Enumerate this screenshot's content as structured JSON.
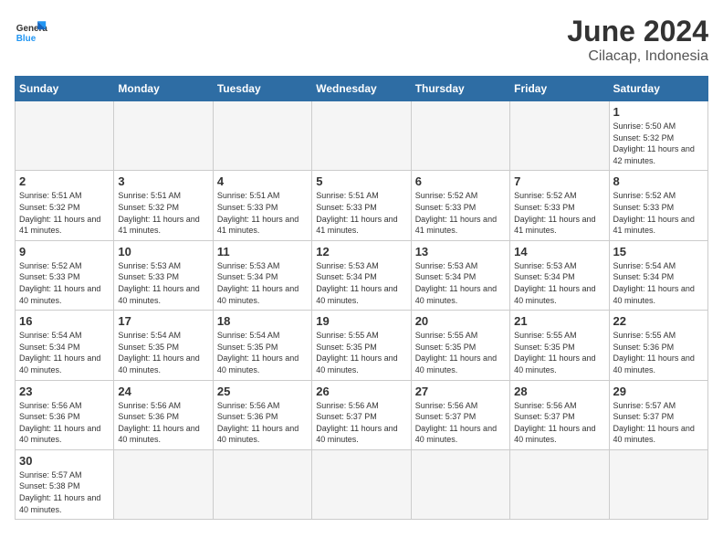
{
  "header": {
    "logo_general": "General",
    "logo_blue": "Blue",
    "title": "June 2024",
    "subtitle": "Cilacap, Indonesia"
  },
  "days_of_week": [
    "Sunday",
    "Monday",
    "Tuesday",
    "Wednesday",
    "Thursday",
    "Friday",
    "Saturday"
  ],
  "weeks": [
    [
      {
        "day": "",
        "sunrise": "",
        "sunset": "",
        "daylight": "",
        "empty": true
      },
      {
        "day": "",
        "sunrise": "",
        "sunset": "",
        "daylight": "",
        "empty": true
      },
      {
        "day": "",
        "sunrise": "",
        "sunset": "",
        "daylight": "",
        "empty": true
      },
      {
        "day": "",
        "sunrise": "",
        "sunset": "",
        "daylight": "",
        "empty": true
      },
      {
        "day": "",
        "sunrise": "",
        "sunset": "",
        "daylight": "",
        "empty": true
      },
      {
        "day": "",
        "sunrise": "",
        "sunset": "",
        "daylight": "",
        "empty": true
      },
      {
        "day": "1",
        "sunrise": "Sunrise: 5:50 AM",
        "sunset": "Sunset: 5:32 PM",
        "daylight": "Daylight: 11 hours and 42 minutes.",
        "empty": false
      }
    ],
    [
      {
        "day": "2",
        "sunrise": "Sunrise: 5:51 AM",
        "sunset": "Sunset: 5:32 PM",
        "daylight": "Daylight: 11 hours and 41 minutes.",
        "empty": false
      },
      {
        "day": "3",
        "sunrise": "Sunrise: 5:51 AM",
        "sunset": "Sunset: 5:32 PM",
        "daylight": "Daylight: 11 hours and 41 minutes.",
        "empty": false
      },
      {
        "day": "4",
        "sunrise": "Sunrise: 5:51 AM",
        "sunset": "Sunset: 5:33 PM",
        "daylight": "Daylight: 11 hours and 41 minutes.",
        "empty": false
      },
      {
        "day": "5",
        "sunrise": "Sunrise: 5:51 AM",
        "sunset": "Sunset: 5:33 PM",
        "daylight": "Daylight: 11 hours and 41 minutes.",
        "empty": false
      },
      {
        "day": "6",
        "sunrise": "Sunrise: 5:52 AM",
        "sunset": "Sunset: 5:33 PM",
        "daylight": "Daylight: 11 hours and 41 minutes.",
        "empty": false
      },
      {
        "day": "7",
        "sunrise": "Sunrise: 5:52 AM",
        "sunset": "Sunset: 5:33 PM",
        "daylight": "Daylight: 11 hours and 41 minutes.",
        "empty": false
      },
      {
        "day": "8",
        "sunrise": "Sunrise: 5:52 AM",
        "sunset": "Sunset: 5:33 PM",
        "daylight": "Daylight: 11 hours and 41 minutes.",
        "empty": false
      }
    ],
    [
      {
        "day": "9",
        "sunrise": "Sunrise: 5:52 AM",
        "sunset": "Sunset: 5:33 PM",
        "daylight": "Daylight: 11 hours and 40 minutes.",
        "empty": false
      },
      {
        "day": "10",
        "sunrise": "Sunrise: 5:53 AM",
        "sunset": "Sunset: 5:33 PM",
        "daylight": "Daylight: 11 hours and 40 minutes.",
        "empty": false
      },
      {
        "day": "11",
        "sunrise": "Sunrise: 5:53 AM",
        "sunset": "Sunset: 5:34 PM",
        "daylight": "Daylight: 11 hours and 40 minutes.",
        "empty": false
      },
      {
        "day": "12",
        "sunrise": "Sunrise: 5:53 AM",
        "sunset": "Sunset: 5:34 PM",
        "daylight": "Daylight: 11 hours and 40 minutes.",
        "empty": false
      },
      {
        "day": "13",
        "sunrise": "Sunrise: 5:53 AM",
        "sunset": "Sunset: 5:34 PM",
        "daylight": "Daylight: 11 hours and 40 minutes.",
        "empty": false
      },
      {
        "day": "14",
        "sunrise": "Sunrise: 5:53 AM",
        "sunset": "Sunset: 5:34 PM",
        "daylight": "Daylight: 11 hours and 40 minutes.",
        "empty": false
      },
      {
        "day": "15",
        "sunrise": "Sunrise: 5:54 AM",
        "sunset": "Sunset: 5:34 PM",
        "daylight": "Daylight: 11 hours and 40 minutes.",
        "empty": false
      }
    ],
    [
      {
        "day": "16",
        "sunrise": "Sunrise: 5:54 AM",
        "sunset": "Sunset: 5:34 PM",
        "daylight": "Daylight: 11 hours and 40 minutes.",
        "empty": false
      },
      {
        "day": "17",
        "sunrise": "Sunrise: 5:54 AM",
        "sunset": "Sunset: 5:35 PM",
        "daylight": "Daylight: 11 hours and 40 minutes.",
        "empty": false
      },
      {
        "day": "18",
        "sunrise": "Sunrise: 5:54 AM",
        "sunset": "Sunset: 5:35 PM",
        "daylight": "Daylight: 11 hours and 40 minutes.",
        "empty": false
      },
      {
        "day": "19",
        "sunrise": "Sunrise: 5:55 AM",
        "sunset": "Sunset: 5:35 PM",
        "daylight": "Daylight: 11 hours and 40 minutes.",
        "empty": false
      },
      {
        "day": "20",
        "sunrise": "Sunrise: 5:55 AM",
        "sunset": "Sunset: 5:35 PM",
        "daylight": "Daylight: 11 hours and 40 minutes.",
        "empty": false
      },
      {
        "day": "21",
        "sunrise": "Sunrise: 5:55 AM",
        "sunset": "Sunset: 5:35 PM",
        "daylight": "Daylight: 11 hours and 40 minutes.",
        "empty": false
      },
      {
        "day": "22",
        "sunrise": "Sunrise: 5:55 AM",
        "sunset": "Sunset: 5:36 PM",
        "daylight": "Daylight: 11 hours and 40 minutes.",
        "empty": false
      }
    ],
    [
      {
        "day": "23",
        "sunrise": "Sunrise: 5:56 AM",
        "sunset": "Sunset: 5:36 PM",
        "daylight": "Daylight: 11 hours and 40 minutes.",
        "empty": false
      },
      {
        "day": "24",
        "sunrise": "Sunrise: 5:56 AM",
        "sunset": "Sunset: 5:36 PM",
        "daylight": "Daylight: 11 hours and 40 minutes.",
        "empty": false
      },
      {
        "day": "25",
        "sunrise": "Sunrise: 5:56 AM",
        "sunset": "Sunset: 5:36 PM",
        "daylight": "Daylight: 11 hours and 40 minutes.",
        "empty": false
      },
      {
        "day": "26",
        "sunrise": "Sunrise: 5:56 AM",
        "sunset": "Sunset: 5:37 PM",
        "daylight": "Daylight: 11 hours and 40 minutes.",
        "empty": false
      },
      {
        "day": "27",
        "sunrise": "Sunrise: 5:56 AM",
        "sunset": "Sunset: 5:37 PM",
        "daylight": "Daylight: 11 hours and 40 minutes.",
        "empty": false
      },
      {
        "day": "28",
        "sunrise": "Sunrise: 5:56 AM",
        "sunset": "Sunset: 5:37 PM",
        "daylight": "Daylight: 11 hours and 40 minutes.",
        "empty": false
      },
      {
        "day": "29",
        "sunrise": "Sunrise: 5:57 AM",
        "sunset": "Sunset: 5:37 PM",
        "daylight": "Daylight: 11 hours and 40 minutes.",
        "empty": false
      }
    ],
    [
      {
        "day": "30",
        "sunrise": "Sunrise: 5:57 AM",
        "sunset": "Sunset: 5:38 PM",
        "daylight": "Daylight: 11 hours and 40 minutes.",
        "empty": false
      },
      {
        "day": "",
        "sunrise": "",
        "sunset": "",
        "daylight": "",
        "empty": true
      },
      {
        "day": "",
        "sunrise": "",
        "sunset": "",
        "daylight": "",
        "empty": true
      },
      {
        "day": "",
        "sunrise": "",
        "sunset": "",
        "daylight": "",
        "empty": true
      },
      {
        "day": "",
        "sunrise": "",
        "sunset": "",
        "daylight": "",
        "empty": true
      },
      {
        "day": "",
        "sunrise": "",
        "sunset": "",
        "daylight": "",
        "empty": true
      },
      {
        "day": "",
        "sunrise": "",
        "sunset": "",
        "daylight": "",
        "empty": true
      }
    ]
  ]
}
